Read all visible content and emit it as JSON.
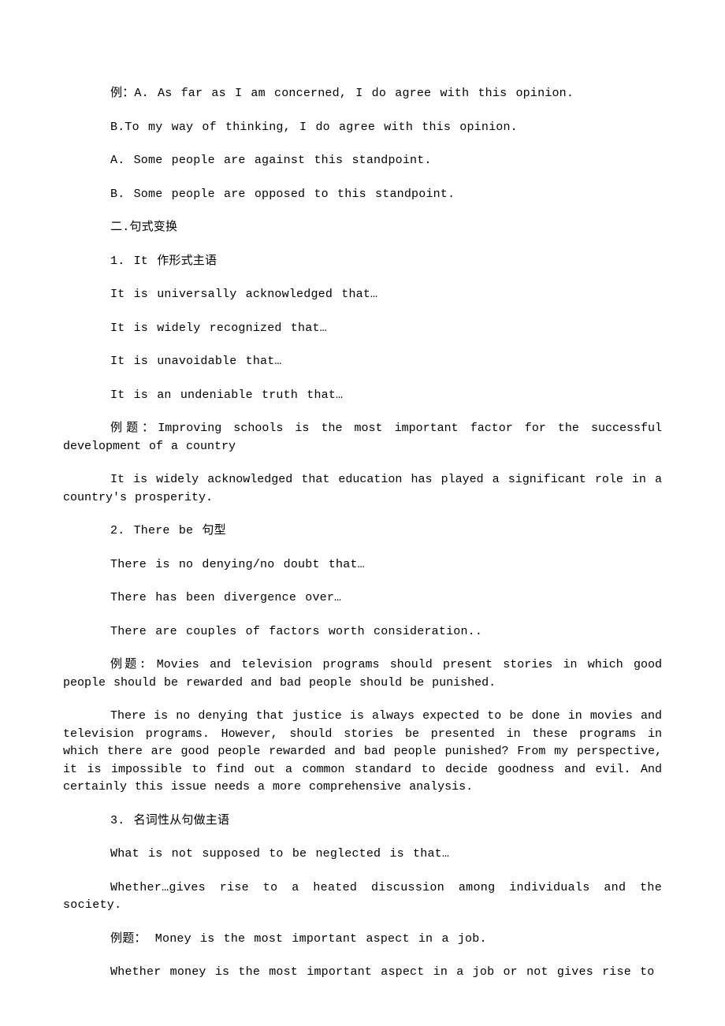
{
  "lines": [
    {
      "class": "paragraph",
      "text": "例：A. As far as I am concerned, I do agree with this opinion."
    },
    {
      "class": "paragraph",
      "text": "B.To my way of thinking, I do agree with this opinion."
    },
    {
      "class": "paragraph",
      "text": "A. Some people are against this standpoint."
    },
    {
      "class": "paragraph",
      "text": "B. Some people are opposed to this standpoint."
    },
    {
      "class": "paragraph",
      "text": "二.句式变换"
    },
    {
      "class": "paragraph",
      "text": "1. It 作形式主语"
    },
    {
      "class": "paragraph",
      "text": "It is universally acknowledged that…"
    },
    {
      "class": "paragraph",
      "text": "It is widely recognized that…"
    },
    {
      "class": "paragraph",
      "text": "It is unavoidable that…"
    },
    {
      "class": "paragraph",
      "text": "It is an undeniable truth that…"
    },
    {
      "class": "paragraph-tight",
      "text": "例题：Improving schools is the most important factor for the successful development of a country"
    },
    {
      "class": "paragraph-tight",
      "text": "It is widely acknowledged that education has played a significant role in a country's prosperity."
    },
    {
      "class": "paragraph",
      "text": "2. There be 句型"
    },
    {
      "class": "paragraph",
      "text": "There is no denying/no doubt that…"
    },
    {
      "class": "paragraph",
      "text": "There has been divergence over…"
    },
    {
      "class": "paragraph",
      "text": "There are couples of factors worth consideration.."
    },
    {
      "class": "paragraph-tight",
      "text": "例题: Movies and television programs should present stories in which good people should be rewarded and bad people should be punished."
    },
    {
      "class": "paragraph-tight",
      "text": "There is no denying that justice is always expected to be done in movies and television programs. However, should stories be presented in these programs in which there are good people rewarded and bad people punished? From my perspective, it is impossible to find out a common standard to decide goodness and evil. And certainly this issue needs a more comprehensive analysis."
    },
    {
      "class": "paragraph",
      "text": "3. 名词性从句做主语"
    },
    {
      "class": "paragraph",
      "text": "What is not supposed to be neglected is that…"
    },
    {
      "class": "paragraph-wide",
      "text": "Whether…gives rise to a heated discussion among individuals and the society."
    },
    {
      "class": "paragraph",
      "text": "例题： Money is the most important aspect in a job."
    },
    {
      "class": "paragraph",
      "text": "Whether money is the most important aspect in a job or not gives rise to"
    }
  ]
}
